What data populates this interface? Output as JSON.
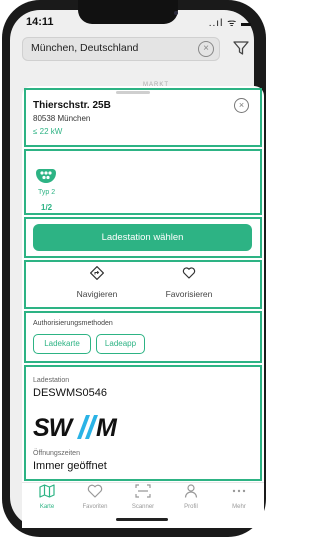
{
  "status_bar": {
    "time": "14:11",
    "icons": "..ıl ᯤ ▬"
  },
  "search": {
    "value": "München, Deutschland"
  },
  "map": {
    "label": "MARKT"
  },
  "station": {
    "title": "Thierschstr. 25B",
    "city": "80538 München",
    "power": "≤ 22 kW"
  },
  "connector": {
    "type": "Typ 2",
    "availability": "1/2"
  },
  "select_button": {
    "label": "Ladestation wählen"
  },
  "actions": {
    "navigate": "Navigieren",
    "favorite": "Favorisieren"
  },
  "auth": {
    "title": "Authorisierungsmethoden",
    "methods": [
      "Ladekarte",
      "Ladeapp"
    ]
  },
  "details": {
    "station_label": "Ladestation",
    "station_id": "DESWMS0546",
    "operator_logo": "SWM",
    "hours_label": "Öffnungszeiten",
    "hours_value": "Immer geöffnet"
  },
  "tabs": [
    {
      "label": "Karte",
      "icon": "map-icon"
    },
    {
      "label": "Favoriten",
      "icon": "heart-icon"
    },
    {
      "label": "Scanner",
      "icon": "scanner-icon"
    },
    {
      "label": "Profil",
      "icon": "profile-icon"
    },
    {
      "label": "Mehr",
      "icon": "more-icon"
    }
  ],
  "colors": {
    "accent": "#2db384"
  }
}
